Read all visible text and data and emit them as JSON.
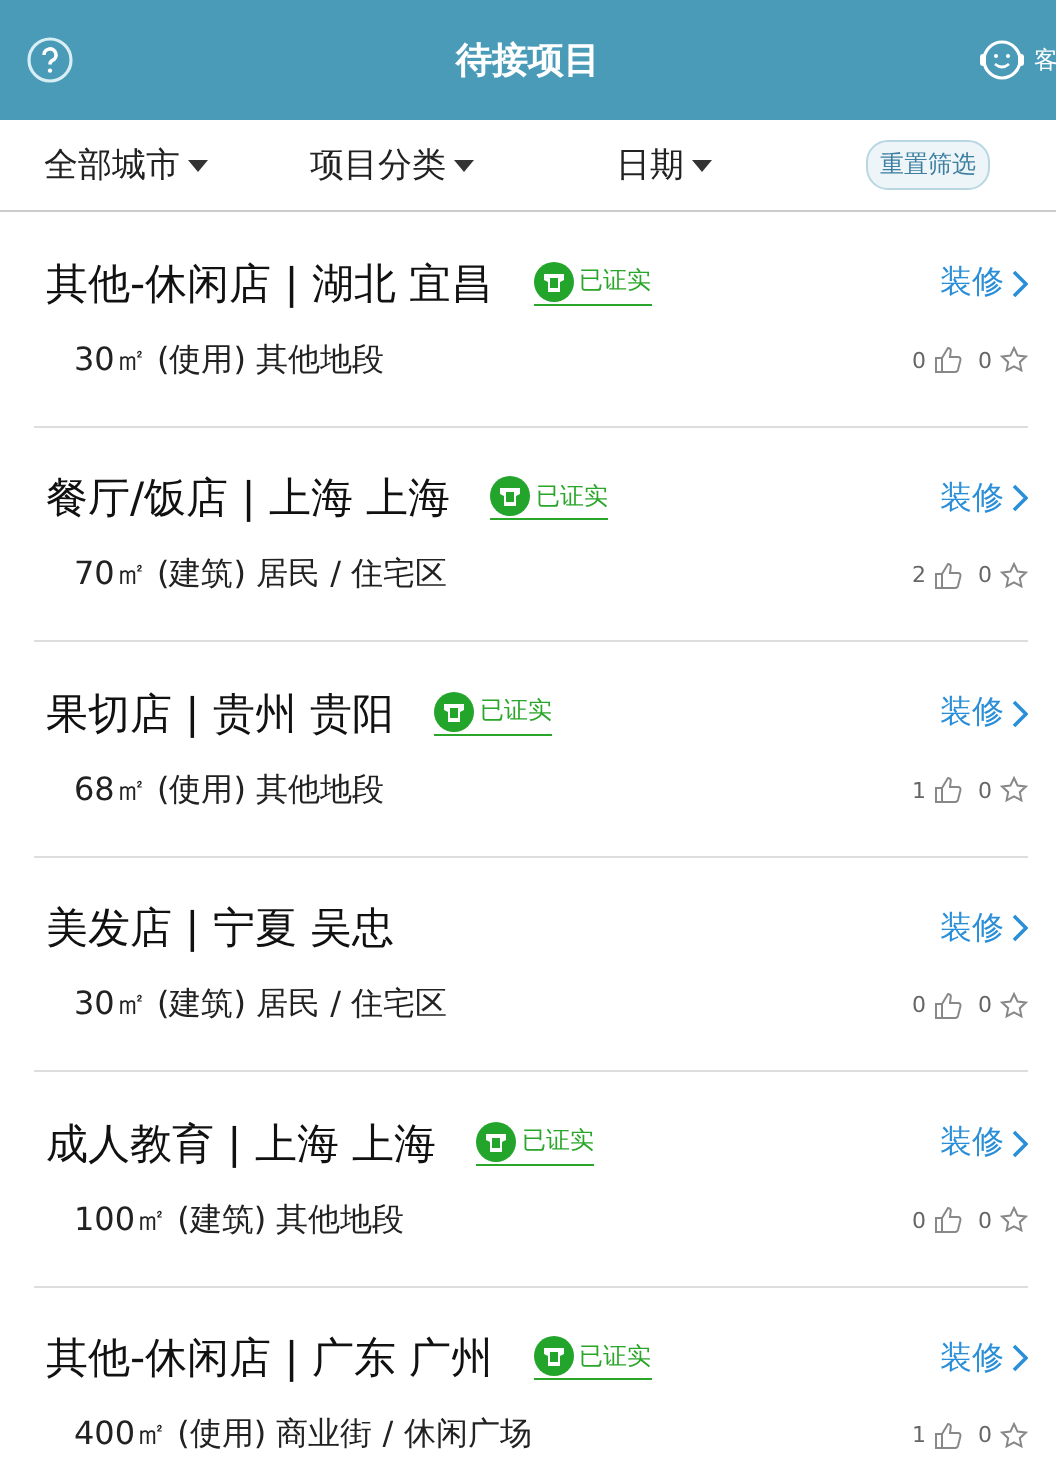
{
  "header": {
    "title": "待接项目",
    "service_label": "客"
  },
  "filters": [
    {
      "label": "全部城市"
    },
    {
      "label": "项目分类"
    },
    {
      "label": "日期"
    }
  ],
  "reset_button": "重置筛选",
  "projects": [
    {
      "title": "其他-休闲店 | 湖北 宜昌",
      "verified": true,
      "verified_label": "已证实",
      "category": "装修",
      "details": "30㎡ (使用) 其他地段",
      "likes": "0",
      "favorites": "0"
    },
    {
      "title": "餐厅/饭店 | 上海 上海",
      "verified": true,
      "verified_label": "已证实",
      "category": "装修",
      "details": "70㎡ (建筑) 居民 / 住宅区",
      "likes": "2",
      "favorites": "0"
    },
    {
      "title": "果切店 | 贵州 贵阳",
      "verified": true,
      "verified_label": "已证实",
      "category": "装修",
      "details": "68㎡ (使用) 其他地段",
      "likes": "1",
      "favorites": "0"
    },
    {
      "title": "美发店 | 宁夏 吴忠",
      "verified": false,
      "category": "装修",
      "details": "30㎡ (建筑) 居民 / 住宅区",
      "likes": "0",
      "favorites": "0"
    },
    {
      "title": "成人教育 | 上海 上海",
      "verified": true,
      "verified_label": "已证实",
      "category": "装修",
      "details": "100㎡ (建筑) 其他地段",
      "likes": "0",
      "favorites": "0"
    },
    {
      "title": "其他-休闲店 | 广东 广州",
      "verified": true,
      "verified_label": "已证实",
      "category": "装修",
      "details": "400㎡ (使用) 商业街 / 休闲广场",
      "likes": "1",
      "favorites": "0"
    }
  ]
}
